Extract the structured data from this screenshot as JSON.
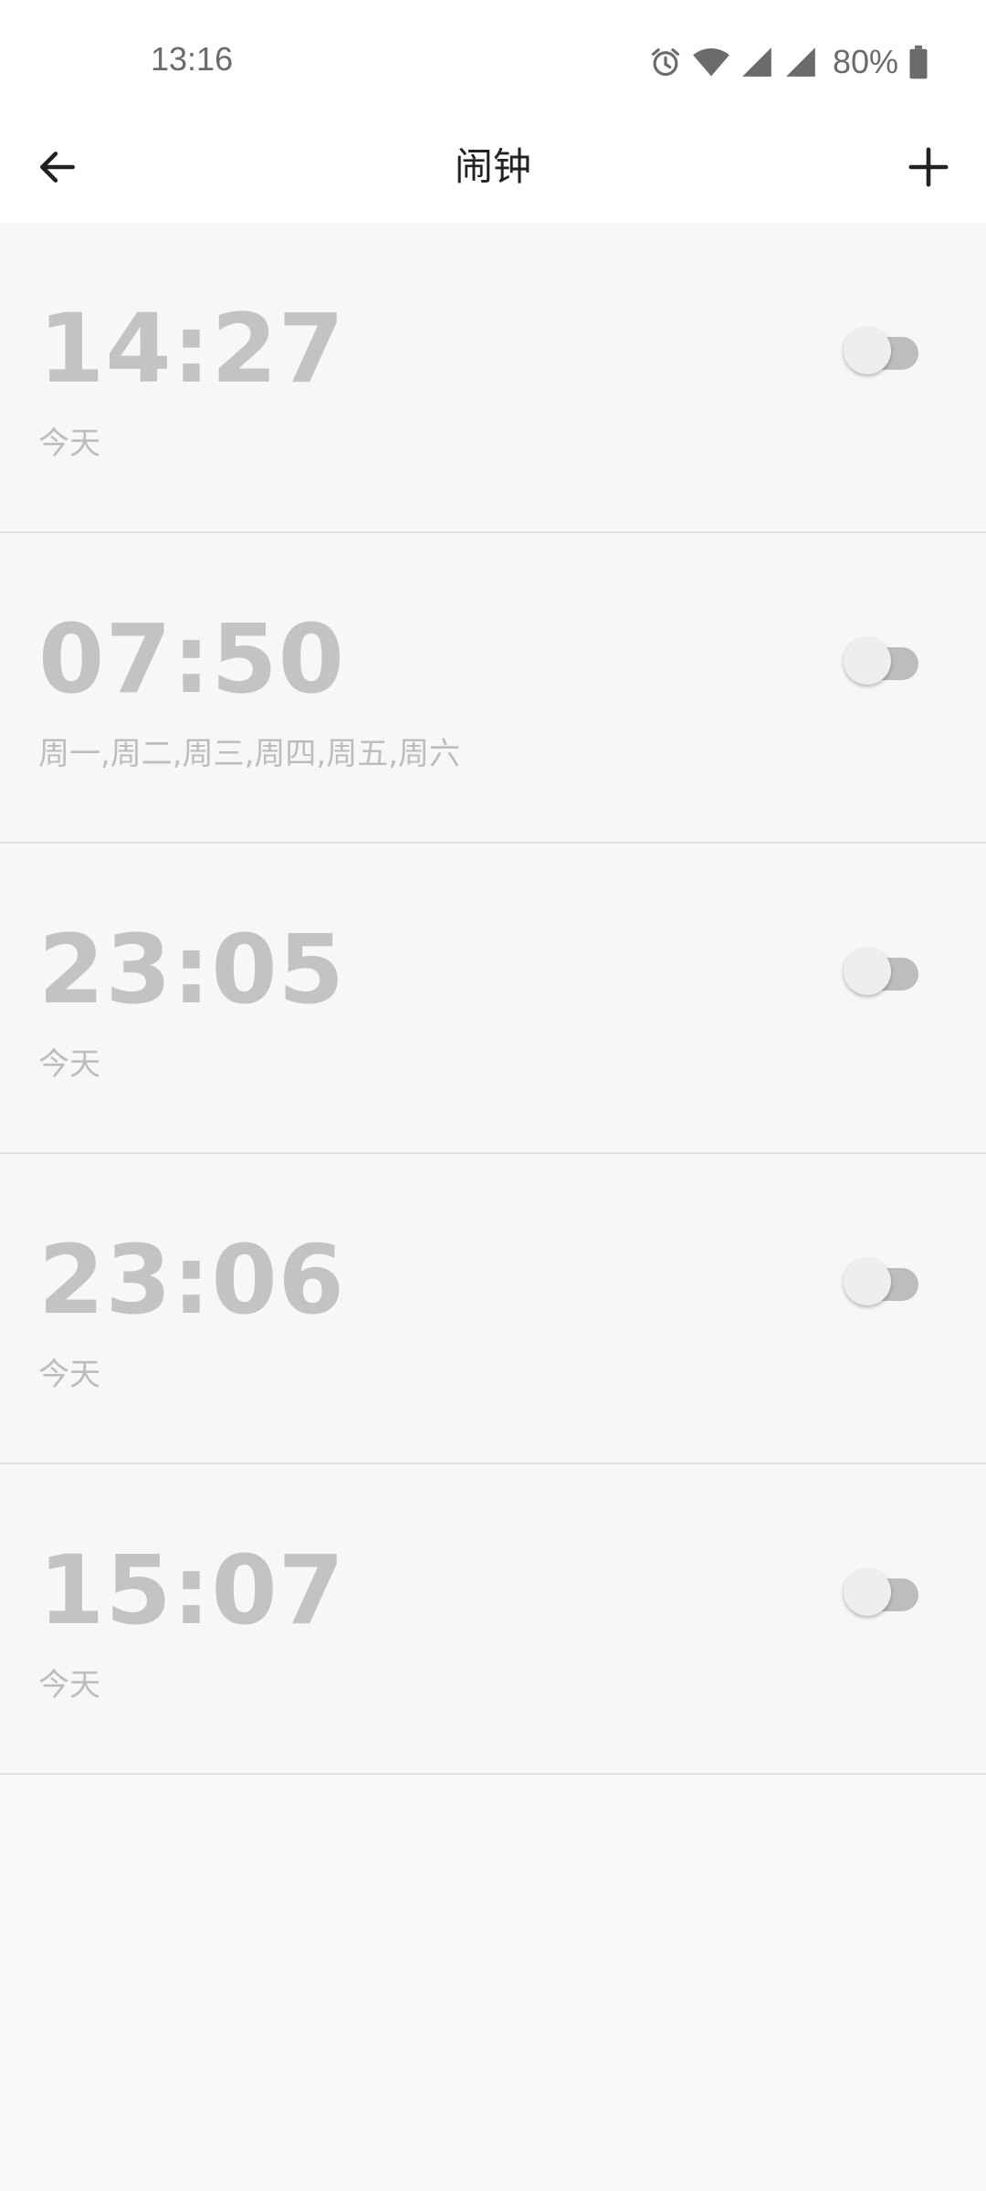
{
  "status_bar": {
    "time": "13:16",
    "battery": "80%",
    "icons": [
      "alarm-icon",
      "wifi-icon",
      "signal-icon",
      "signal-icon",
      "battery-icon"
    ]
  },
  "app_bar": {
    "title": "闹钟",
    "back_icon": "arrow-left-icon",
    "add_icon": "plus-icon"
  },
  "alarms": [
    {
      "time": "14:27",
      "repeat": "今天",
      "enabled": false
    },
    {
      "time": "07:50",
      "repeat": "周一,周二,周三,周四,周五,周六",
      "enabled": false
    },
    {
      "time": "23:05",
      "repeat": "今天",
      "enabled": false
    },
    {
      "time": "23:06",
      "repeat": "今天",
      "enabled": false
    },
    {
      "time": "15:07",
      "repeat": "今天",
      "enabled": false
    }
  ],
  "colors": {
    "background": "#f9f9f9",
    "disabled_text": "#c3c3c3",
    "toggle_track_off": "#bdbdbd",
    "toggle_thumb_off": "#eeeeee"
  }
}
